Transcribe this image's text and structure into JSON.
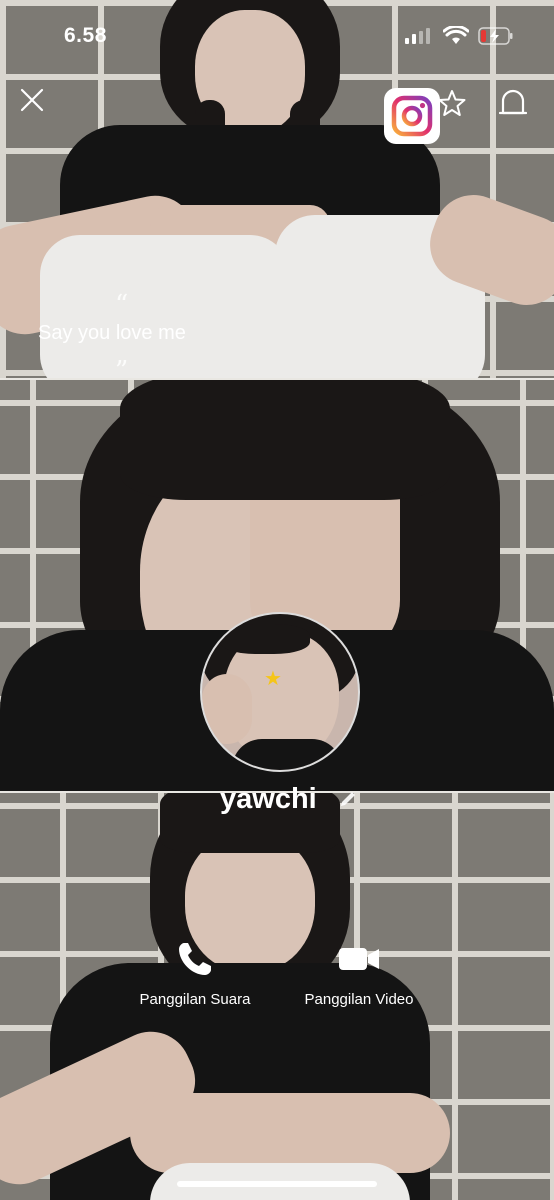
{
  "status_bar": {
    "time": "6.58"
  },
  "header": {
    "close_icon": "close-icon",
    "favorite_icon": "star-icon",
    "notification_icon": "bell-icon",
    "instagram_icon": "instagram-icon"
  },
  "status_message": {
    "open_quote": "“",
    "text": "Say you love me",
    "close_quote": "”"
  },
  "profile": {
    "name": "yawchi",
    "edit_icon": "pencil-icon"
  },
  "actions": {
    "voice_call_label": "Panggilan Suara",
    "video_call_label": "Panggilan Video"
  },
  "colors": {
    "text": "#ffffff",
    "instagram_gradient": [
      "#f9b23b",
      "#e1306c",
      "#7b3fbf"
    ]
  }
}
